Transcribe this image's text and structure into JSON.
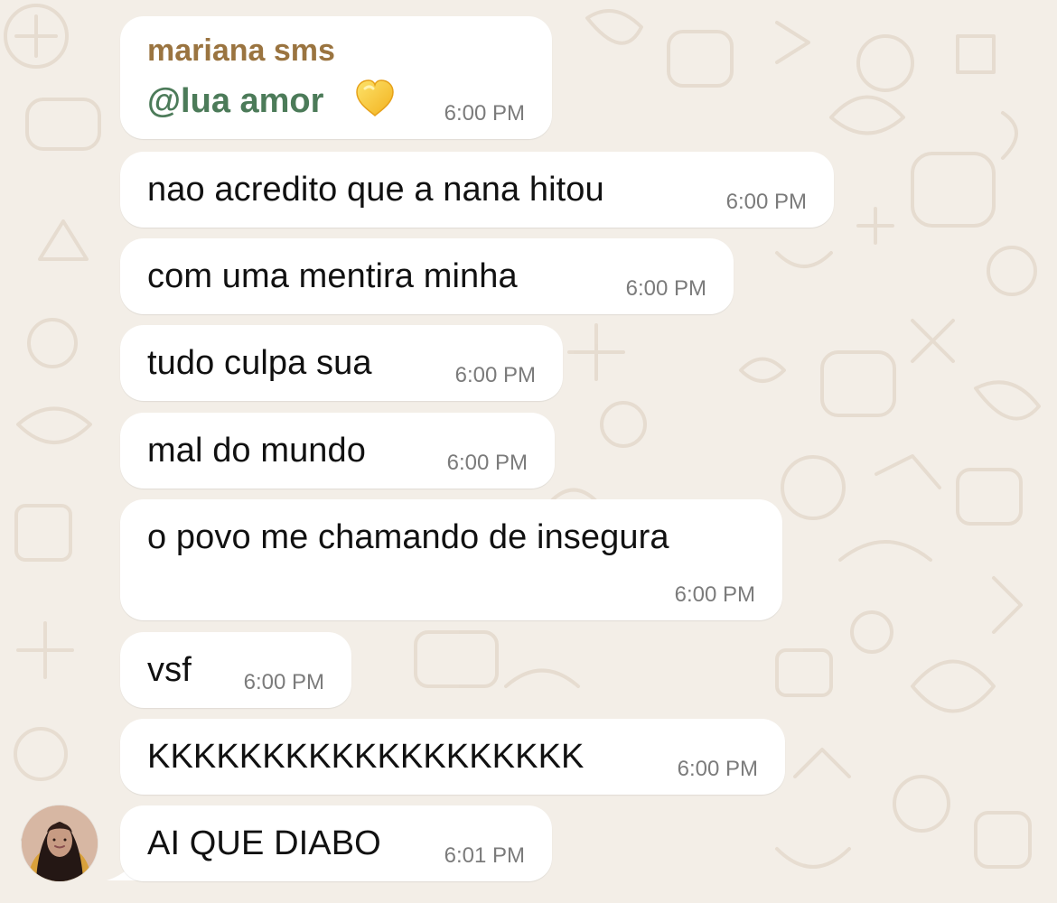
{
  "colors": {
    "background": "#f3eee7",
    "bubble": "#ffffff",
    "sender_name": "#9a7440",
    "mention": "#4c7b59",
    "timestamp": "#7b7b7b"
  },
  "header_message": {
    "sender": "mariana sms",
    "mention": "@lua amor",
    "time": "6:00 PM",
    "emoji_icon": "yellow-heart-icon"
  },
  "messages": [
    {
      "text": "nao acredito que a nana hitou",
      "time": "6:00 PM"
    },
    {
      "text": "com uma mentira minha",
      "time": "6:00 PM"
    },
    {
      "text": "tudo culpa sua",
      "time": "6:00 PM"
    },
    {
      "text": "mal do mundo",
      "time": "6:00 PM"
    },
    {
      "text": "o povo me chamando de insegura",
      "time": "6:00 PM"
    },
    {
      "text": "vsf",
      "time": "6:00 PM"
    },
    {
      "text": "KKKKKKKKKKKKKKKKKKK",
      "time": "6:00 PM"
    },
    {
      "text": "AI QUE DIABO",
      "time": "6:01 PM"
    }
  ],
  "avatar": {
    "icon": "profile-photo-icon"
  }
}
